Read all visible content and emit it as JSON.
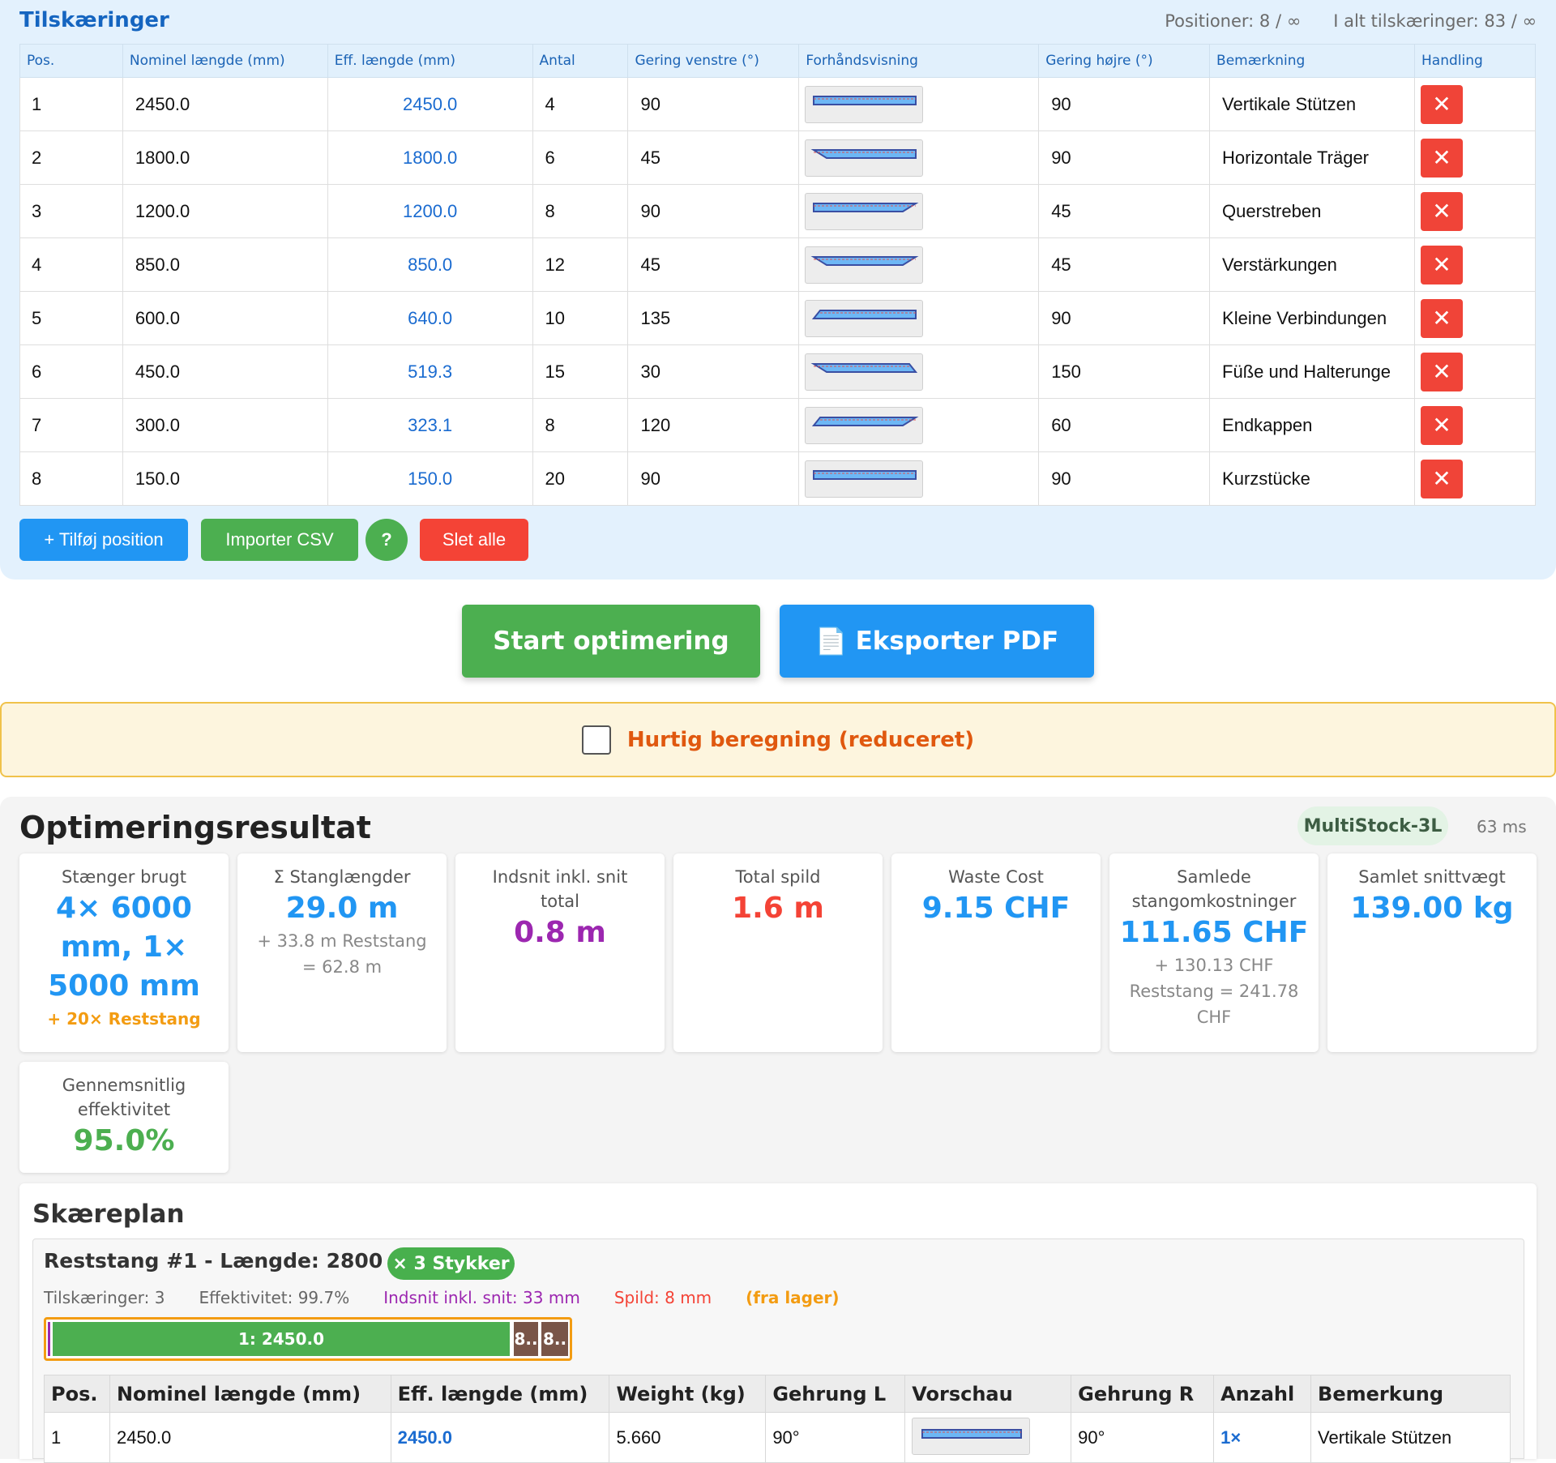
{
  "cuts": {
    "title": "Tilskæringer",
    "positions_label": "Positioner: 8 / ∞",
    "total_label": "I alt tilskæringer: 83 / ∞",
    "headers": [
      "Pos.",
      "Nominel længde (mm)",
      "Eff. længde (mm)",
      "Antal",
      "Gering venstre (°)",
      "Forhåndsvisning",
      "Gering højre (°)",
      "Bemærkning",
      "Handling"
    ],
    "rows": [
      {
        "pos": "1",
        "nominal": "2450.0",
        "eff": "2450.0",
        "qty": "4",
        "left": "90",
        "right": "90",
        "note": "Vertikale Stützen"
      },
      {
        "pos": "2",
        "nominal": "1800.0",
        "eff": "1800.0",
        "qty": "6",
        "left": "45",
        "right": "90",
        "note": "Horizontale Träger"
      },
      {
        "pos": "3",
        "nominal": "1200.0",
        "eff": "1200.0",
        "qty": "8",
        "left": "90",
        "right": "45",
        "note": "Querstreben"
      },
      {
        "pos": "4",
        "nominal": "850.0",
        "eff": "850.0",
        "qty": "12",
        "left": "45",
        "right": "45",
        "note": "Verstärkungen"
      },
      {
        "pos": "5",
        "nominal": "600.0",
        "eff": "640.0",
        "qty": "10",
        "left": "135",
        "right": "90",
        "note": "Kleine Verbindungen"
      },
      {
        "pos": "6",
        "nominal": "450.0",
        "eff": "519.3",
        "qty": "15",
        "left": "30",
        "right": "150",
        "note": "Füße und Halterunge"
      },
      {
        "pos": "7",
        "nominal": "300.0",
        "eff": "323.1",
        "qty": "8",
        "left": "120",
        "right": "60",
        "note": "Endkappen"
      },
      {
        "pos": "8",
        "nominal": "150.0",
        "eff": "150.0",
        "qty": "20",
        "left": "90",
        "right": "90",
        "note": "Kurzstücke"
      }
    ],
    "delete_symbol": "✕",
    "buttons": {
      "add": "+ Tilføj position",
      "import": "Importer CSV",
      "help": "?",
      "clear": "Slet alle"
    }
  },
  "actions": {
    "start": "Start optimering",
    "export_icon": "📄",
    "export": "Eksporter PDF"
  },
  "fast": {
    "label": "Hurtig beregning (reduceret)",
    "checked": false
  },
  "results": {
    "title": "Optimeringsresultat",
    "algorithm": "MultiStock-3L",
    "time": "63 ms",
    "cards": [
      {
        "label": "Stænger brugt",
        "value": "4× 6000 mm, 1× 5000 mm",
        "sub": "+ 20× Reststang",
        "color": "#2196f3"
      },
      {
        "label": "Σ Stanglængder",
        "value": "29.0 m",
        "sub": "+ 33.8 m Reststang = 62.8 m",
        "color": "#2196f3"
      },
      {
        "label": "Indsnit inkl. snit total",
        "value": "0.8 m",
        "sub": "",
        "color": "#9c27b0"
      },
      {
        "label": "Total spild",
        "value": "1.6 m",
        "sub": "",
        "color": "#f44336"
      },
      {
        "label": "Waste Cost",
        "value": "9.15 CHF",
        "sub": "",
        "color": "#2196f3"
      },
      {
        "label": "Samlede stangomkostninger",
        "value": "111.65 CHF",
        "sub": "+ 130.13 CHF Reststang = 241.78 CHF",
        "color": "#2196f3"
      },
      {
        "label": "Samlet snittvægt",
        "value": "139.00 kg",
        "sub": "",
        "color": "#2196f3"
      },
      {
        "label": "Gennemsnitlig effektivitet",
        "value": "95.0%",
        "sub": "",
        "color": "#4caf50"
      }
    ]
  },
  "plan": {
    "title": "Skæreplan",
    "bar": {
      "heading": "Reststang #1 - Længde: 2800 mm",
      "qty": "× 3 Stykker",
      "cuts": "Tilskæringer: 3",
      "efficiency": "Effektivitet: 99.7%",
      "kerf": "Indsnit inkl. snit: 33 mm",
      "waste": "Spild: 8 mm",
      "source": "(fra lager)",
      "segments": [
        {
          "label": "1: 2450.0",
          "color": "#4caf50"
        },
        {
          "label": "8..",
          "color": "#795548"
        },
        {
          "label": "8..",
          "color": "#795548"
        }
      ]
    },
    "headers": [
      "Pos.",
      "Nominel længde (mm)",
      "Eff. længde (mm)",
      "Weight (kg)",
      "Gehrung L",
      "Vorschau",
      "Gehrung R",
      "Anzahl",
      "Bemerkung"
    ],
    "rows": [
      {
        "pos": "1",
        "nominal": "2450.0",
        "eff": "2450.0",
        "weight": "5.660",
        "left": "90°",
        "right": "90°",
        "qty": "1×",
        "note": "Vertikale Stützen"
      }
    ]
  }
}
